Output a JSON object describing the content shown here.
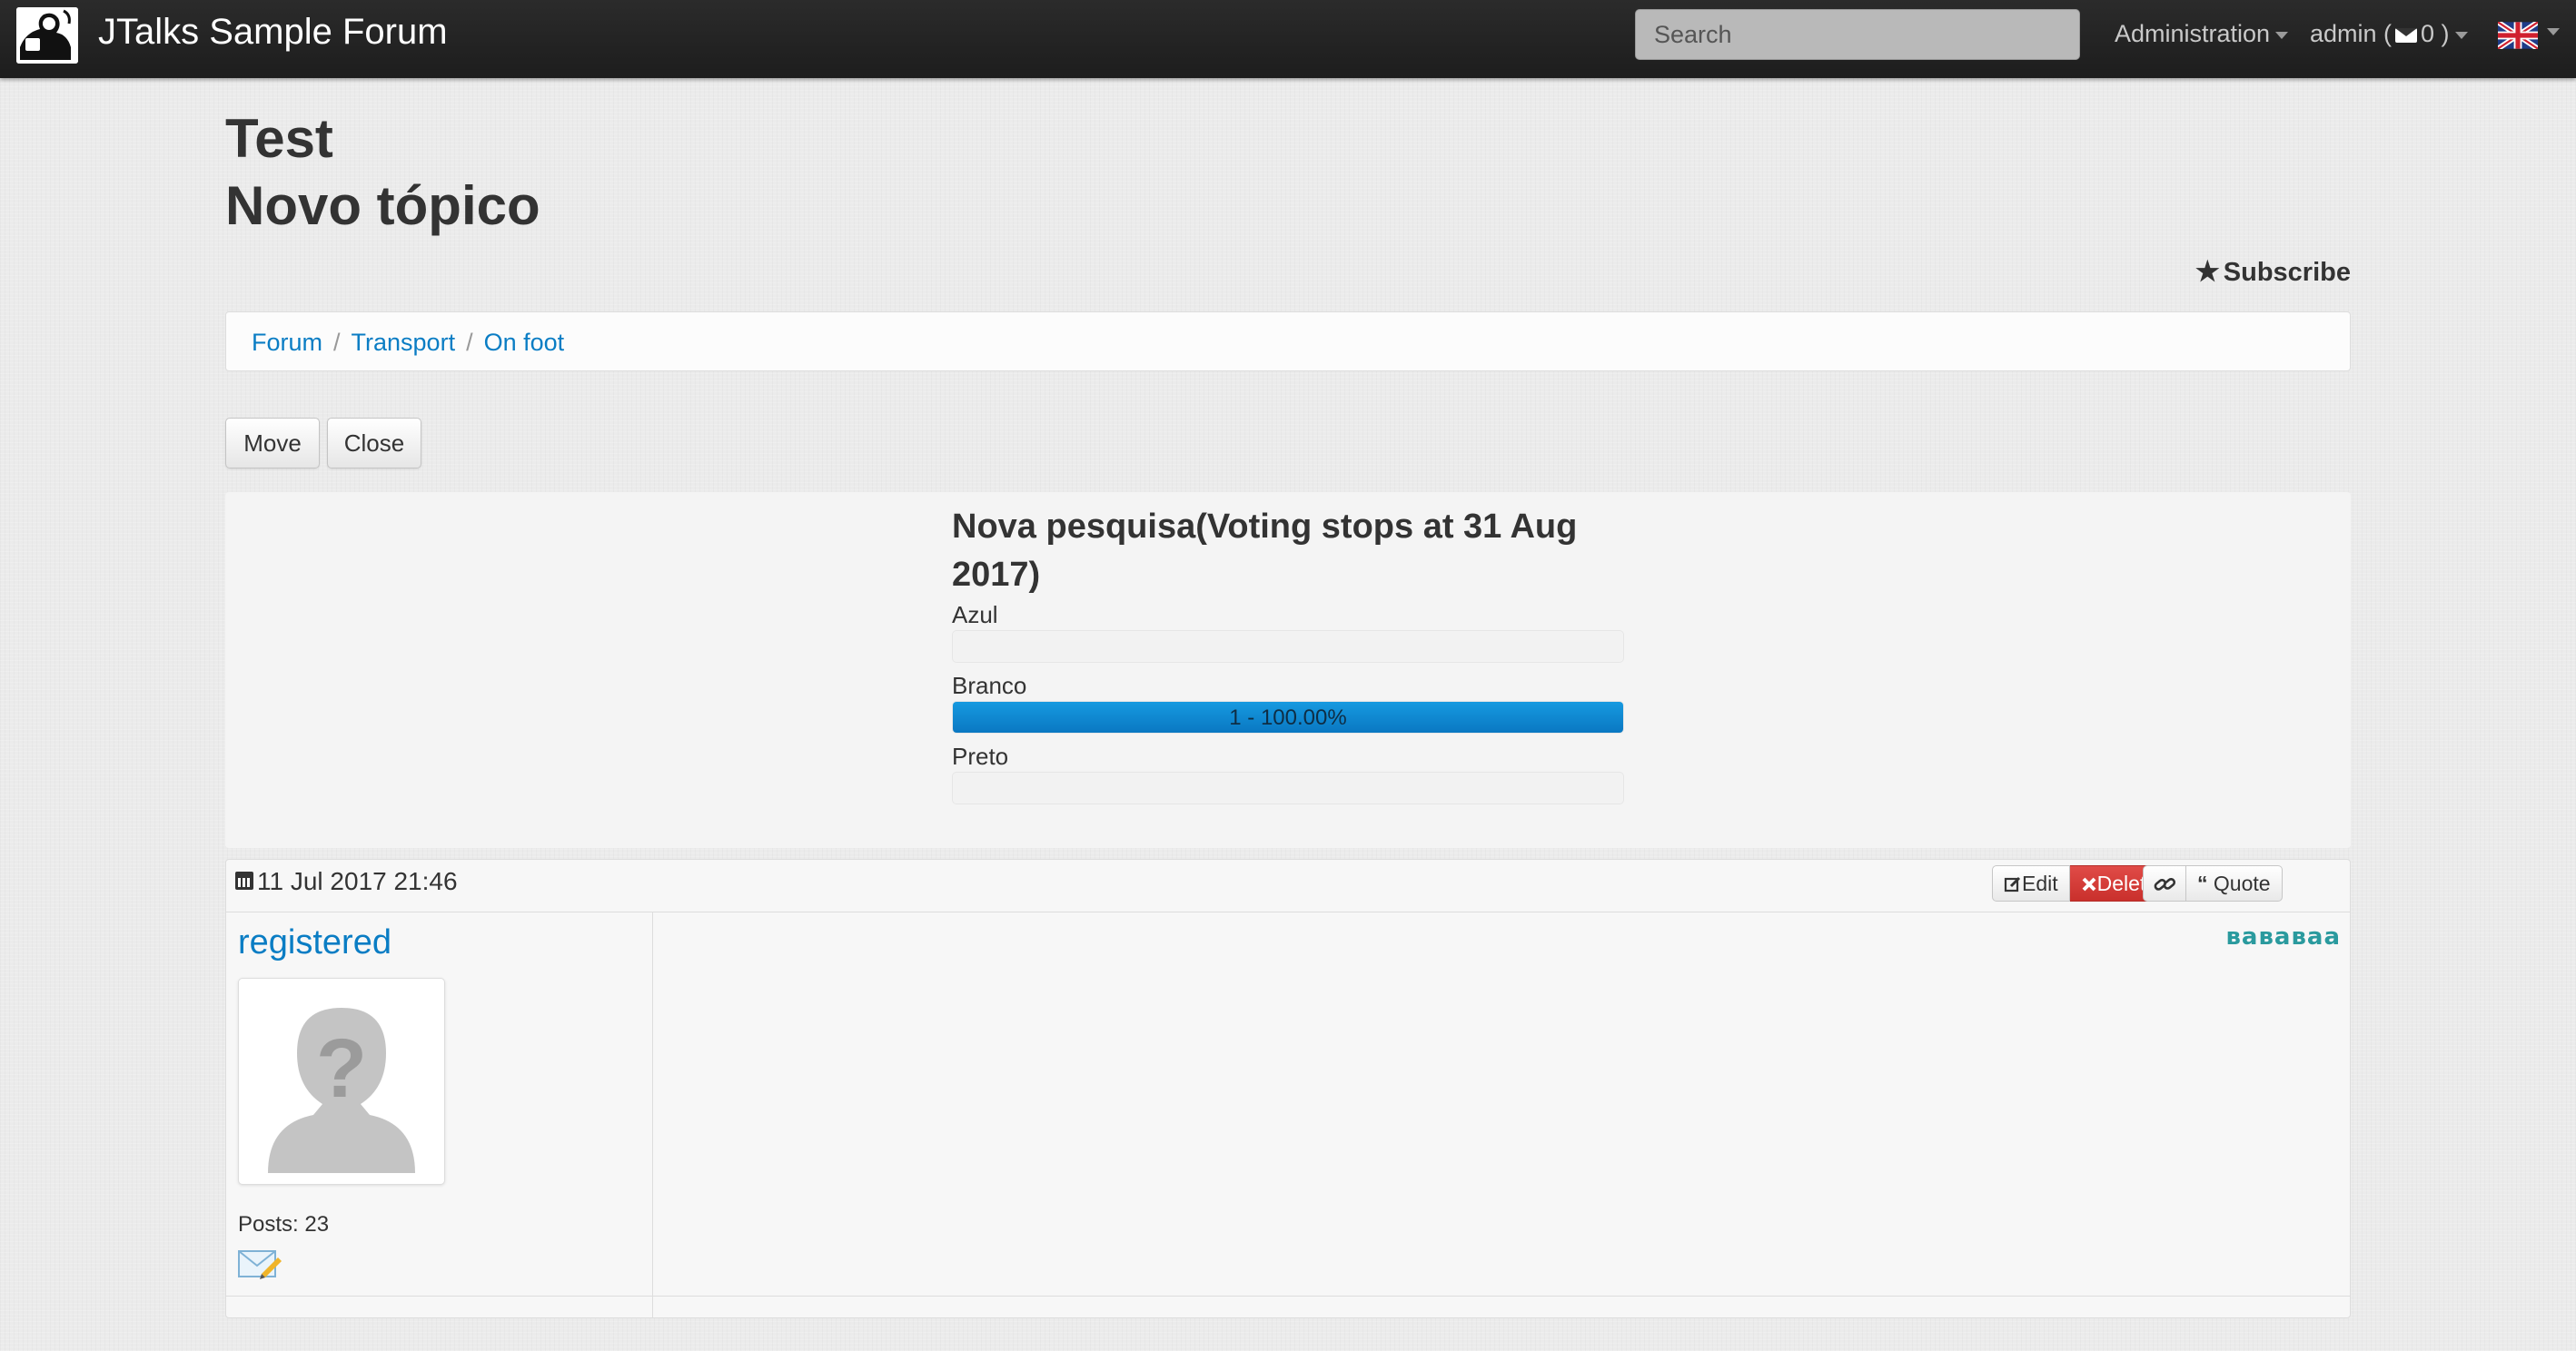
{
  "navbar": {
    "brand": "JTalks Sample Forum",
    "search_placeholder": "Search",
    "admin_menu": "Administration",
    "user_prefix": "admin (",
    "user_count": "0 )",
    "language_icon": "uk-flag-icon"
  },
  "header": {
    "title_line1": "Test",
    "title_line2": "Novo tópico",
    "subscribe_star": "★",
    "subscribe": "Subscribe"
  },
  "breadcrumb": {
    "items": [
      "Forum",
      "Transport",
      "On foot"
    ],
    "separator": "/"
  },
  "actions": {
    "move": "Move",
    "close": "Close"
  },
  "poll": {
    "title": "Nova pesquisa(Voting stops at 31 Aug 2017)",
    "options": [
      {
        "label": "Azul",
        "percent": 0,
        "text": ""
      },
      {
        "label": "Branco",
        "percent": 100,
        "text": "1 - 100.00%"
      },
      {
        "label": "Preto",
        "percent": 0,
        "text": ""
      }
    ],
    "bar_color": "#0a88d0"
  },
  "post": {
    "date": "11 Jul 2017 21:46",
    "buttons": {
      "edit": "Edit",
      "delete": "Delete",
      "quote": "Quote"
    },
    "author": {
      "name": "registered",
      "posts_label": "Posts: 23"
    },
    "content": "ʙаʙаʙаа"
  },
  "colors": {
    "link": "#0a7dc4",
    "danger": "#d9534f",
    "content_text": "#2a9a9e"
  }
}
